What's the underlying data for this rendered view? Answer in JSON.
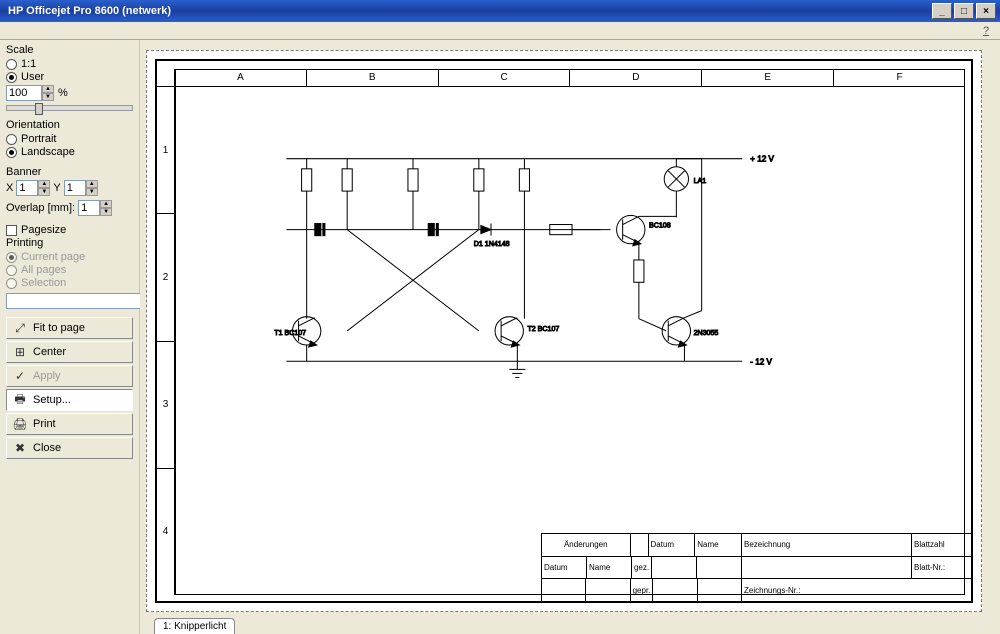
{
  "window": {
    "title": "HP Officejet Pro 8600 (netwerk)"
  },
  "sidebar": {
    "scale": {
      "title": "Scale",
      "opt_11": "1:1",
      "opt_user": "User",
      "value": "100",
      "percent": "%"
    },
    "orientation": {
      "title": "Orientation",
      "opt_portrait": "Portrait",
      "opt_landscape": "Landscape"
    },
    "banner": {
      "title": "Banner",
      "x_label": "X",
      "y_label": "Y",
      "x_value": "1",
      "y_value": "1",
      "overlap_label": "Overlap [mm]:",
      "overlap_value": "1"
    },
    "pagesize": {
      "label": "Pagesize"
    },
    "printing": {
      "title": "Printing",
      "opt_current": "Current page",
      "opt_all": "All pages",
      "opt_selection": "Selection"
    },
    "buttons": {
      "fit": "Fit to page",
      "center": "Center",
      "apply": "Apply",
      "setup": "Setup...",
      "print": "Print",
      "close": "Close"
    }
  },
  "preview": {
    "cols": [
      "A",
      "B",
      "C",
      "D",
      "E",
      "F"
    ],
    "rows": [
      "1",
      "2",
      "3",
      "4"
    ],
    "voltages": {
      "top": "+ 12 V",
      "bottom": "- 12 V"
    },
    "components": {
      "t1": "T1\nBC107",
      "t2": "T2\nBC107",
      "t3": "BC108",
      "t4": "2N3055",
      "d1": "D1\n1N4148",
      "la1": "LA1"
    },
    "titleblock": {
      "header": "Änderungen",
      "col_datum": "Datum",
      "col_name": "Name",
      "col_bez": "Bezeichnung",
      "col_blattzahl": "Blattzahl",
      "row_datum": "Datum",
      "row_name": "Name",
      "gez": "gez.",
      "gepr": "gepr.",
      "zeich": "Zeichnungs-Nr.:",
      "blattnr": "Blatt-Nr.:"
    },
    "tab": "1: Knipperlicht"
  }
}
